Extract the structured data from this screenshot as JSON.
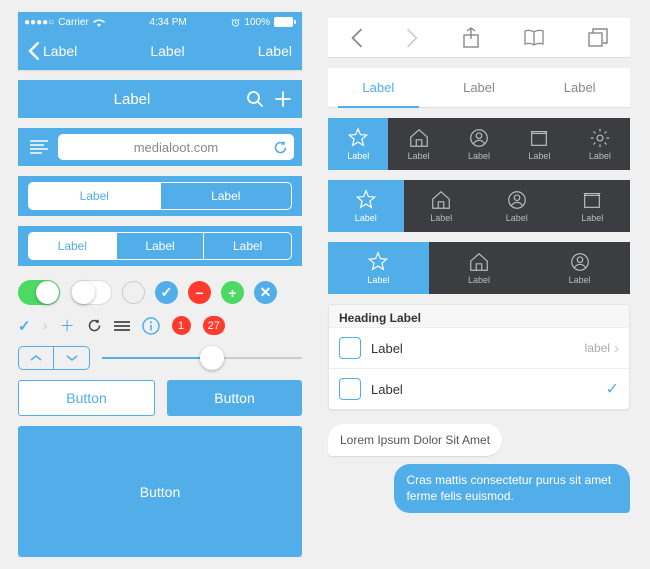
{
  "status": {
    "carrier": "Carrier",
    "time": "4:34 PM",
    "battery": "100%"
  },
  "nav": {
    "back": "Label",
    "title": "Label",
    "right": "Label"
  },
  "titlebar": {
    "title": "Label"
  },
  "url": {
    "value": "medialoot.com"
  },
  "seg2": [
    "Label",
    "Label"
  ],
  "seg3": [
    "Label",
    "Label",
    "Label"
  ],
  "badges": {
    "one": "1",
    "two": "27"
  },
  "buttons": {
    "outline": "Button",
    "fill": "Button",
    "wide": "Button"
  },
  "texttabs": [
    "Label",
    "Label",
    "Label"
  ],
  "tabbar5": [
    "Label",
    "Label",
    "Label",
    "Label",
    "Label"
  ],
  "tabbar4": [
    "Label",
    "Label",
    "Label",
    "Label"
  ],
  "tabbar3": [
    "Label",
    "Label",
    "Label"
  ],
  "list": {
    "heading": "Heading Label",
    "row1": {
      "title": "Label",
      "trail": "label"
    },
    "row2": {
      "title": "Label"
    }
  },
  "chat": {
    "in": "Lorem Ipsum Dolor Sit Amet",
    "out": "Cras mattis consectetur purus sit amet ferme felis euismod."
  }
}
